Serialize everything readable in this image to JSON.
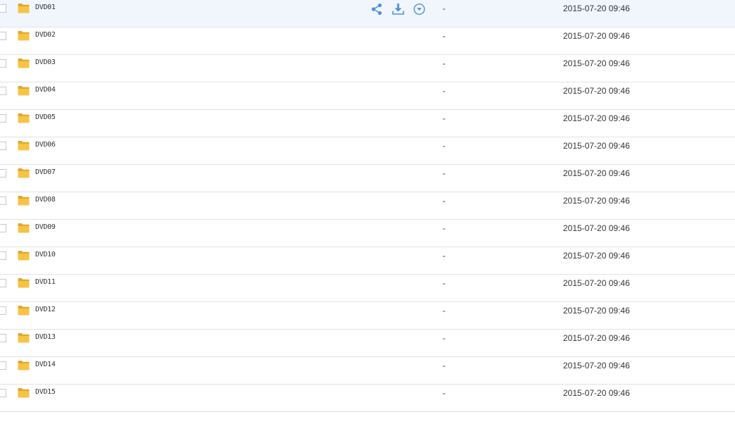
{
  "colors": {
    "folder": "#f6c445",
    "folder_dark": "#e0a92a",
    "action_icon": "#4f8fd8",
    "hover_row": "#f1f6fc",
    "divider": "#e2e2e2"
  },
  "files": [
    {
      "name": "DVD01",
      "size": "-",
      "modified": "2015-07-20 09:46"
    },
    {
      "name": "DVD02",
      "size": "-",
      "modified": "2015-07-20 09:46"
    },
    {
      "name": "DVD03",
      "size": "-",
      "modified": "2015-07-20 09:46"
    },
    {
      "name": "DVD04",
      "size": "-",
      "modified": "2015-07-20 09:46"
    },
    {
      "name": "DVD05",
      "size": "-",
      "modified": "2015-07-20 09:46"
    },
    {
      "name": "DVD06",
      "size": "-",
      "modified": "2015-07-20 09:46"
    },
    {
      "name": "DVD07",
      "size": "-",
      "modified": "2015-07-20 09:46"
    },
    {
      "name": "DVD08",
      "size": "-",
      "modified": "2015-07-20 09:46"
    },
    {
      "name": "DVD09",
      "size": "-",
      "modified": "2015-07-20 09:46"
    },
    {
      "name": "DVD10",
      "size": "-",
      "modified": "2015-07-20 09:46"
    },
    {
      "name": "DVD11",
      "size": "-",
      "modified": "2015-07-20 09:46"
    },
    {
      "name": "DVD12",
      "size": "-",
      "modified": "2015-07-20 09:46"
    },
    {
      "name": "DVD13",
      "size": "-",
      "modified": "2015-07-20 09:46"
    },
    {
      "name": "DVD14",
      "size": "-",
      "modified": "2015-07-20 09:46"
    },
    {
      "name": "DVD15",
      "size": "-",
      "modified": "2015-07-20 09:46"
    }
  ],
  "hovered_row": 0,
  "row_actions": [
    {
      "icon": "share-icon"
    },
    {
      "icon": "download-icon"
    },
    {
      "icon": "more-dropdown-icon"
    }
  ]
}
